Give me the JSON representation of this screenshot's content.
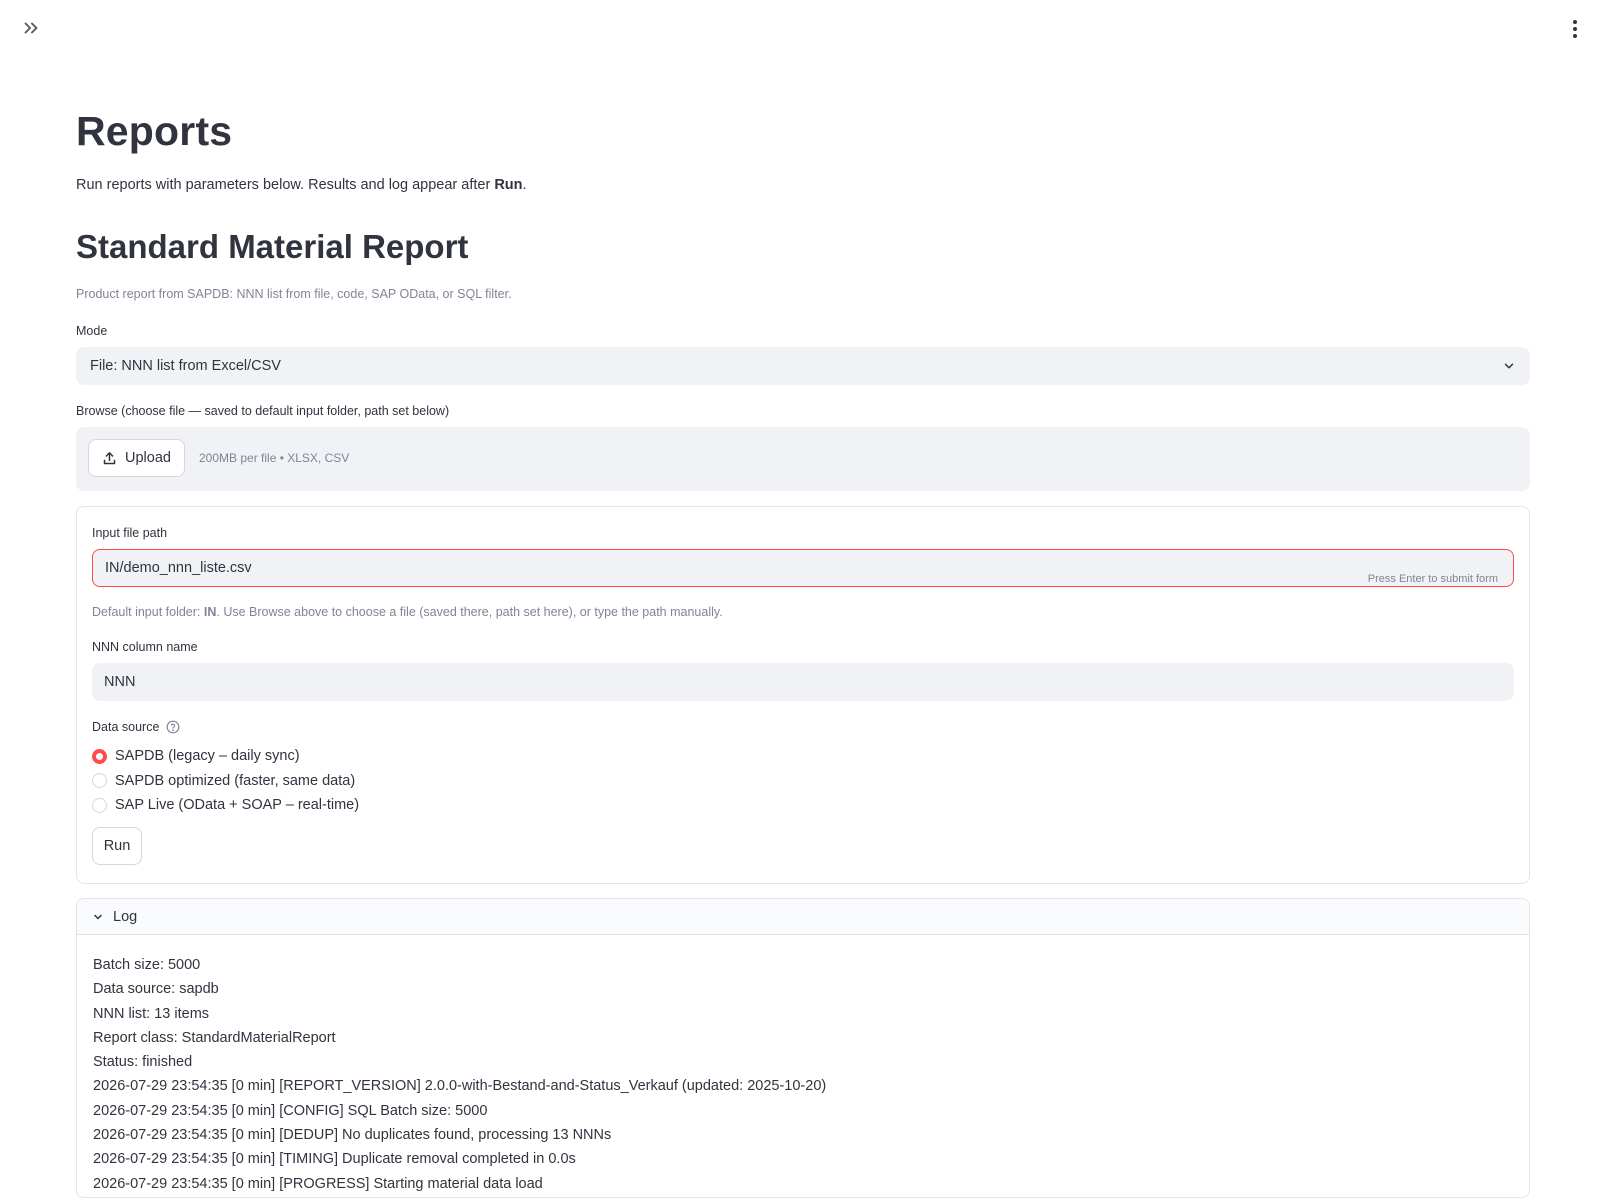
{
  "page": {
    "title": "Reports",
    "subtitle_prefix": "Run reports with parameters below. Results and log appear after ",
    "subtitle_bold": "Run",
    "subtitle_suffix": "."
  },
  "report": {
    "title": "Standard Material Report",
    "caption": "Product report from SAPDB: NNN list from file, code, SAP OData, or SQL filter."
  },
  "mode": {
    "label": "Mode",
    "selected": "File: NNN list from Excel/CSV"
  },
  "browse": {
    "label": "Browse (choose file — saved to default input folder, path set below)",
    "button_label": "Upload",
    "hint": "200MB per file • XLSX, CSV"
  },
  "input_file": {
    "label": "Input file path",
    "value": "IN/demo_nnn_liste.csv",
    "enter_hint": "Press Enter to submit form",
    "help_prefix": "Default input folder: ",
    "help_bold": "IN",
    "help_suffix": ". Use Browse above to choose a file (saved there, path set here), or type the path manually."
  },
  "nnn_column": {
    "label": "NNN column name",
    "value": "NNN"
  },
  "data_source": {
    "label": "Data source",
    "options": [
      "SAPDB (legacy – daily sync)",
      "SAPDB optimized (faster, same data)",
      "SAP Live (OData + SOAP – real-time)"
    ],
    "selected_index": 0
  },
  "run_button_label": "Run",
  "log": {
    "header": "Log",
    "lines": [
      "Batch size: 5000",
      "Data source: sapdb",
      "NNN list: 13 items",
      "Report class: StandardMaterialReport",
      "Status: finished",
      "2026-07-29 23:54:35 [0 min] [REPORT_VERSION] 2.0.0-with-Bestand-and-Status_Verkauf (updated: 2025-10-20)",
      "2026-07-29 23:54:35 [0 min] [CONFIG] SQL Batch size: 5000",
      "2026-07-29 23:54:35 [0 min] [DEDUP] No duplicates found, processing 13 NNNs",
      "2026-07-29 23:54:35 [0 min] [TIMING] Duplicate removal completed in 0.0s",
      "2026-07-29 23:54:35 [0 min] [PROGRESS] Starting material data load"
    ]
  },
  "colors": {
    "accent": "#ff4b4b",
    "text": "#31333f",
    "muted": "#808495",
    "input_bg": "#f0f2f6"
  }
}
